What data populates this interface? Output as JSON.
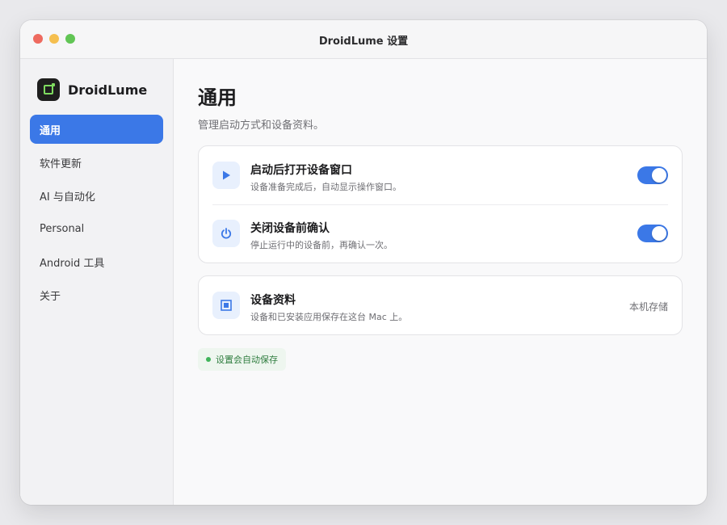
{
  "window": {
    "title": "DroidLume 设置"
  },
  "brand": {
    "name": "DroidLume"
  },
  "sidebar": {
    "items": [
      {
        "label": "通用",
        "active": true
      },
      {
        "label": "软件更新"
      },
      {
        "label": "AI 与自动化"
      },
      {
        "label": "Personal"
      },
      {
        "label": "Android 工具"
      },
      {
        "label": "关于"
      }
    ]
  },
  "main": {
    "title": "通用",
    "subtitle": "管理启动方式和设备资料。",
    "settings": [
      {
        "icon": "play-icon",
        "title": "启动后打开设备窗口",
        "description": "设备准备完成后，自动显示操作窗口。",
        "enabled": true
      },
      {
        "icon": "power-icon",
        "title": "关闭设备前确认",
        "description": "停止运行中的设备前，再确认一次。",
        "enabled": true
      }
    ],
    "storage": {
      "icon": "storage-icon",
      "title": "设备资料",
      "description": "设备和已安装应用保存在这台 Mac 上。",
      "value": "本机存储"
    },
    "status": "设置会自动保存"
  },
  "colors": {
    "accent": "#3b78e7",
    "success": "#3fb45a"
  }
}
